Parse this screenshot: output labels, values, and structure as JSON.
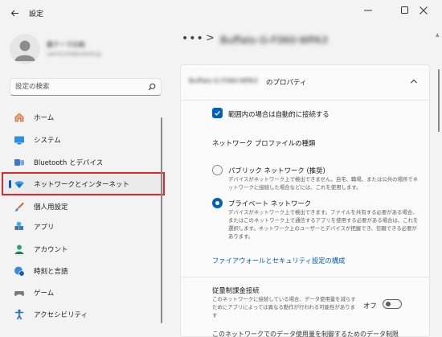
{
  "window": {
    "title": "設定",
    "controls": [
      "minimize-icon",
      "maximize-icon",
      "close-icon"
    ]
  },
  "profile": {
    "name": "藤テーマ比較",
    "email": "user01234@outlook.jp"
  },
  "search": {
    "placeholder": "設定の検索"
  },
  "nav": {
    "items": [
      {
        "label": "ホーム",
        "icon": "home-icon"
      },
      {
        "label": "システム",
        "icon": "system-icon"
      },
      {
        "label": "Bluetooth とデバイス",
        "icon": "bluetooth-icon"
      },
      {
        "label": "ネットワークとインターネット",
        "icon": "wifi-icon",
        "selected": true
      },
      {
        "label": "個人用設定",
        "icon": "brush-icon"
      },
      {
        "label": "アプリ",
        "icon": "apps-icon"
      },
      {
        "label": "アカウント",
        "icon": "account-icon"
      },
      {
        "label": "時刻と言語",
        "icon": "globe-clock-icon"
      },
      {
        "label": "ゲーム",
        "icon": "gamepad-icon"
      },
      {
        "label": "アクセシビリティ",
        "icon": "accessibility-icon"
      }
    ]
  },
  "breadcrumb": {
    "dots": "•••",
    "chevron": ">",
    "title": "Buffalo-G-F060-WPA3"
  },
  "card": {
    "header_name": "Buffalo-G-F060-WPA3",
    "header_suffix": "のプロパティ",
    "auto_connect_label": "範囲内の場合は自動的に接続する",
    "profile_type_heading": "ネットワーク プロファイルの種類",
    "public_title": "パブリック ネットワーク (推奨)",
    "public_desc": "デバイスがネットワーク上で検出できません。自宅、職場、または公共の場所でネットワークに接続した場合などには、これを使用します。",
    "private_title": "プライベート ネットワーク",
    "private_desc": "デバイスがネットワーク上で検出できます。ファイルを共有する必要がある場合、またはこのネットワーク上で通信するアプリを使用する必要がある場合は、これを選択します。ネットワーク上のユーザーとデバイスが把握でき、信頼できる必要があります。",
    "firewall_link": "ファイアウォールとセキュリティ設定の構成",
    "metered_title": "従量制課金接続",
    "metered_desc": "このネットワークに接続している場合、データ使用量を減らすためにアプリによっては異なる動作が行われる可能性があります",
    "metered_state": "オフ",
    "bottom_cut": "このネットワークでのデータ使用量を制御するためのデータ制限"
  },
  "colors": {
    "accent": "#005fb8",
    "highlight_box": "#e3262a",
    "window_bg": "#f3f3f3",
    "card_bg": "#fbfbfb"
  }
}
